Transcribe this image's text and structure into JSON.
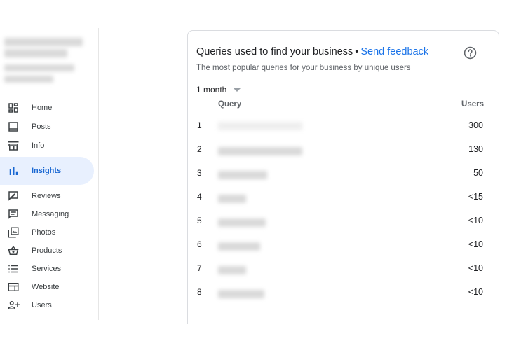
{
  "sidebar": {
    "items": [
      {
        "label": "Home",
        "icon": "dashboard-icon"
      },
      {
        "label": "Posts",
        "icon": "posts-icon"
      },
      {
        "label": "Info",
        "icon": "storefront-icon"
      },
      {
        "label": "Insights",
        "icon": "bar-chart-icon",
        "active": true
      },
      {
        "label": "Reviews",
        "icon": "reviews-icon"
      },
      {
        "label": "Messaging",
        "icon": "message-icon"
      },
      {
        "label": "Photos",
        "icon": "photos-icon"
      },
      {
        "label": "Products",
        "icon": "basket-icon"
      },
      {
        "label": "Services",
        "icon": "list-icon"
      },
      {
        "label": "Website",
        "icon": "web-icon"
      },
      {
        "label": "Users",
        "icon": "add-user-icon"
      }
    ]
  },
  "card": {
    "title": "Queries used to find your business",
    "separator": "•",
    "feedback_link": "Send feedback",
    "subtitle": "The most popular queries for your business by unique users",
    "period": "1 month",
    "columns": {
      "query": "Query",
      "users": "Users"
    },
    "rows": [
      {
        "rank": "1",
        "users": "300"
      },
      {
        "rank": "2",
        "users": "130"
      },
      {
        "rank": "3",
        "users": "50"
      },
      {
        "rank": "4",
        "users": "<15"
      },
      {
        "rank": "5",
        "users": "<10"
      },
      {
        "rank": "6",
        "users": "<10"
      },
      {
        "rank": "7",
        "users": "<10"
      },
      {
        "rank": "8",
        "users": "<10"
      }
    ]
  },
  "colors": {
    "accent": "#1a73e8",
    "active_bg": "#e8f0fe",
    "active_text": "#1967d2"
  }
}
